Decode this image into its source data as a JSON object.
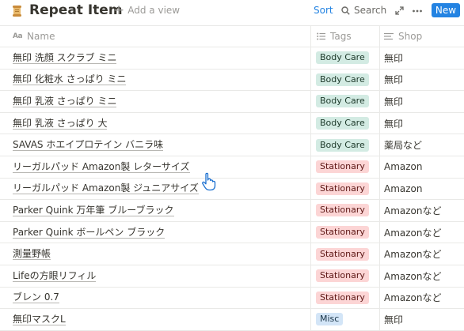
{
  "header": {
    "title": "Repeat Item",
    "add_view": "Add a view",
    "sort": "Sort",
    "search": "Search",
    "new": "New"
  },
  "columns": {
    "name": "Name",
    "tags": "Tags",
    "shop": "Shop"
  },
  "rows": [
    {
      "name": "無印 洗顔 スクラブ ミニ",
      "tag": "Body Care",
      "shop": "無印"
    },
    {
      "name": "無印 化粧水 さっぱり ミニ",
      "tag": "Body Care",
      "shop": "無印"
    },
    {
      "name": "無印 乳液 さっぱり ミニ",
      "tag": "Body Care",
      "shop": "無印"
    },
    {
      "name": "無印 乳液 さっぱり 大",
      "tag": "Body Care",
      "shop": "無印"
    },
    {
      "name": "SAVAS ホエイプロテイン バニラ味",
      "tag": "Body Care",
      "shop": "薬局など"
    },
    {
      "name": "リーガルパッド Amazon製 レターサイズ",
      "tag": "Stationary",
      "shop": "Amazon"
    },
    {
      "name": "リーガルパッド Amazon製 ジュニアサイズ",
      "tag": "Stationary",
      "shop": "Amazon"
    },
    {
      "name": "Parker Quink 万年筆 ブルーブラック",
      "tag": "Stationary",
      "shop": "Amazonなど"
    },
    {
      "name": "Parker Quink ボールペン ブラック",
      "tag": "Stationary",
      "shop": "Amazonなど"
    },
    {
      "name": "測量野帳",
      "tag": "Stationary",
      "shop": "Amazonなど"
    },
    {
      "name": "Lifeの方眼リフィル",
      "tag": "Stationary",
      "shop": "Amazonなど"
    },
    {
      "name": "ブレン 0.7",
      "tag": "Stationary",
      "shop": "Amazonなど"
    },
    {
      "name": "無印マスクL",
      "tag": "Misc",
      "shop": "無印"
    }
  ],
  "tag_colors": {
    "Body Care": {
      "bg": "#d3ebe3",
      "fg": "#1c3829"
    },
    "Stationary": {
      "bg": "#fcd5d5",
      "fg": "#5d1715"
    },
    "Misc": {
      "bg": "#d3e5f7",
      "fg": "#183347"
    }
  },
  "colors": {
    "accent": "#2383e2",
    "border": "#e9e9e7",
    "muted": "#9b9a97"
  }
}
